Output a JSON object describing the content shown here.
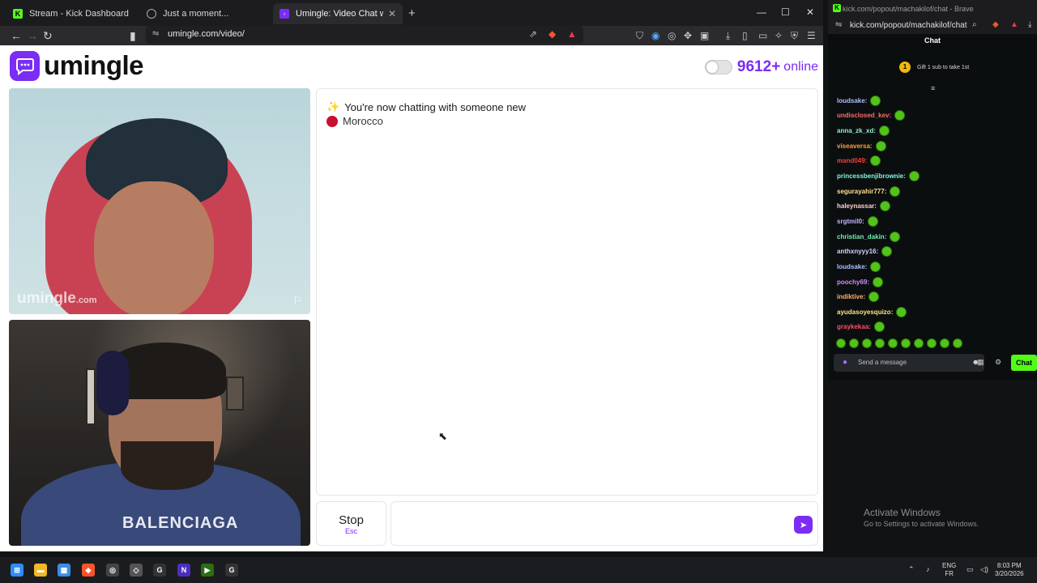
{
  "browser": {
    "tabs": [
      {
        "label": "Stream - Kick Dashboard",
        "favicon": "kick-icon",
        "color": "#53fc18"
      },
      {
        "label": "Just a moment...",
        "favicon": "globe-icon",
        "color": "#777"
      },
      {
        "label": "Umingle: Video Chat with Str",
        "favicon": "umingle-icon",
        "color": "#7b2cf5"
      }
    ],
    "url": "umingle.com/video/"
  },
  "umingle": {
    "logo_text": "umingle",
    "online_count": "9612+",
    "online_label": "online",
    "watermark": "umingle",
    "watermark_suffix": ".com",
    "chat_message": "You're now chatting with someone new",
    "country": "Morocco",
    "stop_label": "Stop",
    "stop_key": "Esc",
    "shirt_text": "BALENCIAGA",
    "accent": "#7b2cf5"
  },
  "kick": {
    "window_title": "kick.com/popout/machakilof/chat - Brave",
    "url": "kick.com/popout/machakilof/chat",
    "header": "Chat",
    "sub_badge": "1",
    "sub_text": "Gift 1 sub to take 1st",
    "messages": [
      {
        "user": "loudsake:",
        "color": "#a9c3ff"
      },
      {
        "user": "undisclosed_kev:",
        "color": "#ff6b6b"
      },
      {
        "user": "anna_zk_xd:",
        "color": "#8ef0c8"
      },
      {
        "user": "viseaversa:",
        "color": "#ff9f3a"
      },
      {
        "user": "mand049:",
        "color": "#ff3b3b"
      },
      {
        "user": "princessbenjibrownie:",
        "color": "#7ef5e0"
      },
      {
        "user": "segurayahir777:",
        "color": "#ffe08a"
      },
      {
        "user": "haleynassar:",
        "color": "#ffd0d0"
      },
      {
        "user": "srgtmil0:",
        "color": "#c2b3ff"
      },
      {
        "user": "christian_dakin:",
        "color": "#6ff0b0"
      },
      {
        "user": "anthxnyyy16:",
        "color": "#cfd5ff"
      },
      {
        "user": "loudsake:",
        "color": "#a9c3ff"
      },
      {
        "user": "poochy69:",
        "color": "#d28bff"
      },
      {
        "user": "indiktive:",
        "color": "#ffb36b"
      },
      {
        "user": "ayudasoyesquizo:",
        "color": "#ffe680"
      },
      {
        "user": "graykekaa:",
        "color": "#ff4d6d"
      }
    ],
    "input_placeholder": "Send a message",
    "chat_button": "Chat",
    "brand": "#53fc18"
  },
  "windows": {
    "activate_title": "Activate Windows",
    "activate_sub": "Go to Settings to activate Windows.",
    "lang_top": "ENG",
    "lang_bottom": "FR",
    "time": "8:03 PM",
    "date": "3/20/2026"
  }
}
